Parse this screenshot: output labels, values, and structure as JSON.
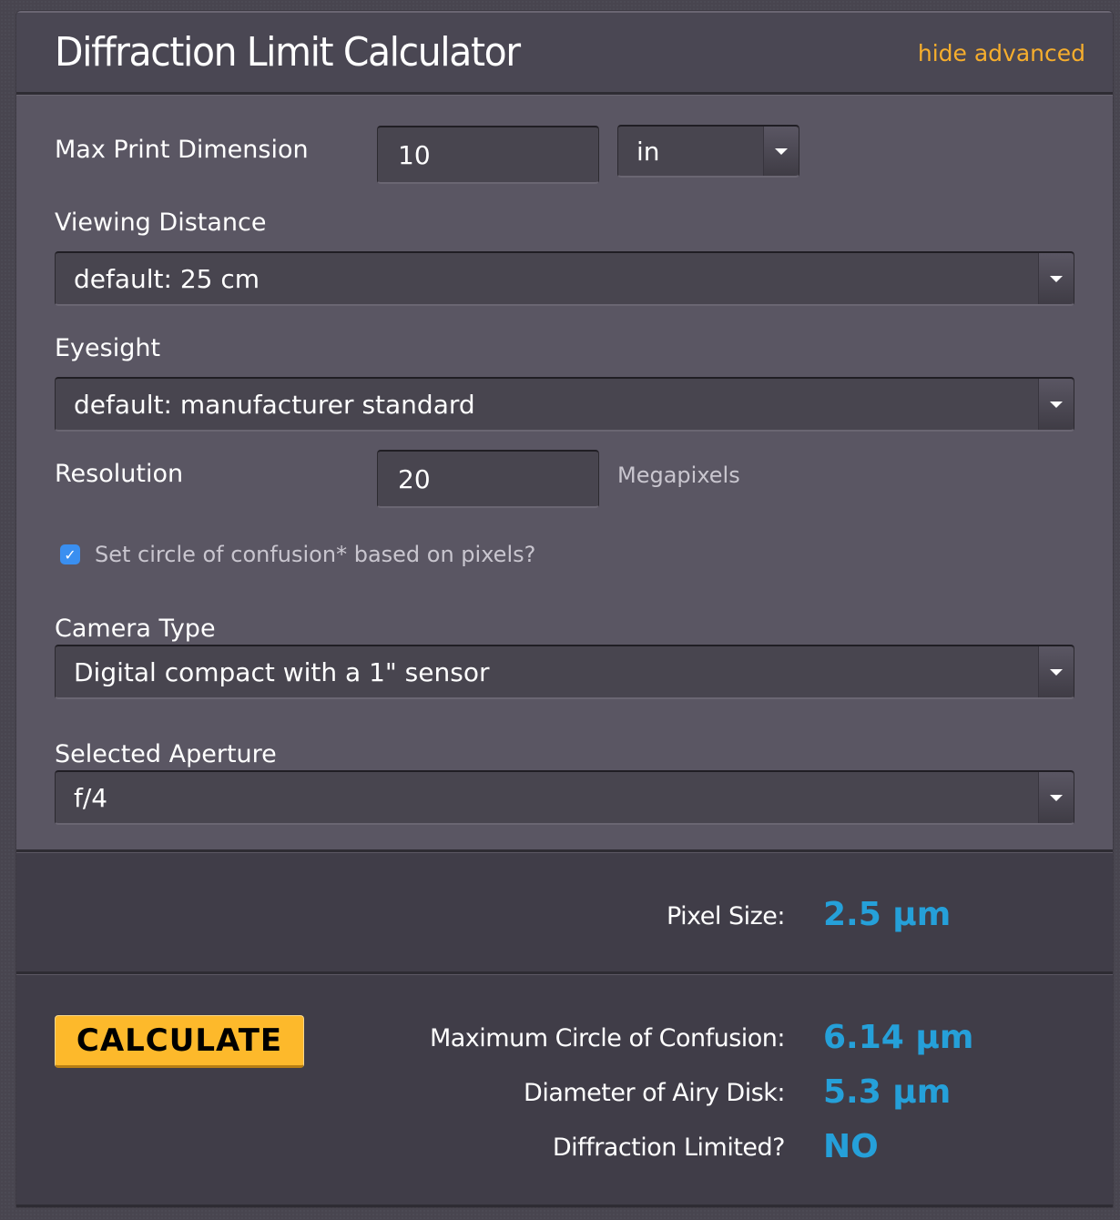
{
  "header": {
    "title": "Diffraction Limit Calculator",
    "toggle_advanced": "hide advanced"
  },
  "form": {
    "max_print": {
      "label": "Max Print Dimension",
      "value": "10",
      "unit_selected": "in"
    },
    "viewing_distance": {
      "label": "Viewing Distance",
      "selected": "default: 25 cm"
    },
    "eyesight": {
      "label": "Eyesight",
      "selected": "default: manufacturer standard"
    },
    "resolution": {
      "label": "Resolution",
      "value": "20",
      "unit": "Megapixels"
    },
    "coc_checkbox": {
      "label": "Set circle of confusion* based on pixels?",
      "checked": true,
      "check_glyph": "✓"
    },
    "camera_type": {
      "label": "Camera Type",
      "selected": "Digital compact with a 1\" sensor"
    },
    "aperture": {
      "label": "Selected Aperture",
      "selected": "f/4"
    }
  },
  "results": {
    "pixel_size": {
      "label": "Pixel Size:",
      "value": "2.5 µm"
    },
    "calculate_button": "CALCULATE",
    "max_coc": {
      "label": "Maximum Circle of Confusion:",
      "value": "6.14 µm"
    },
    "airy_disk": {
      "label": "Diameter of Airy Disk:",
      "value": "5.3 µm"
    },
    "diffraction_limited": {
      "label": "Diffraction Limited?",
      "value": "NO"
    }
  },
  "colors": {
    "accent_link": "#f6ae2d",
    "result_value": "#25a0d9",
    "button": "#fdb92b",
    "checkbox": "#3a8ff0"
  }
}
